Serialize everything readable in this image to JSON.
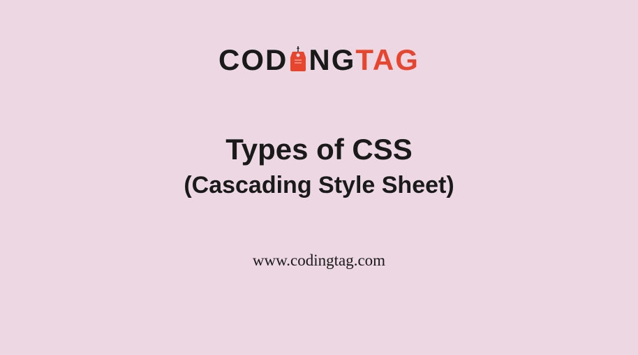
{
  "logo": {
    "part1": "COD",
    "part2": "NG",
    "part3": "TAG"
  },
  "heading": {
    "title": "Types of CSS",
    "subtitle": "(Cascading Style Sheet)"
  },
  "url": "www.codingtag.com"
}
